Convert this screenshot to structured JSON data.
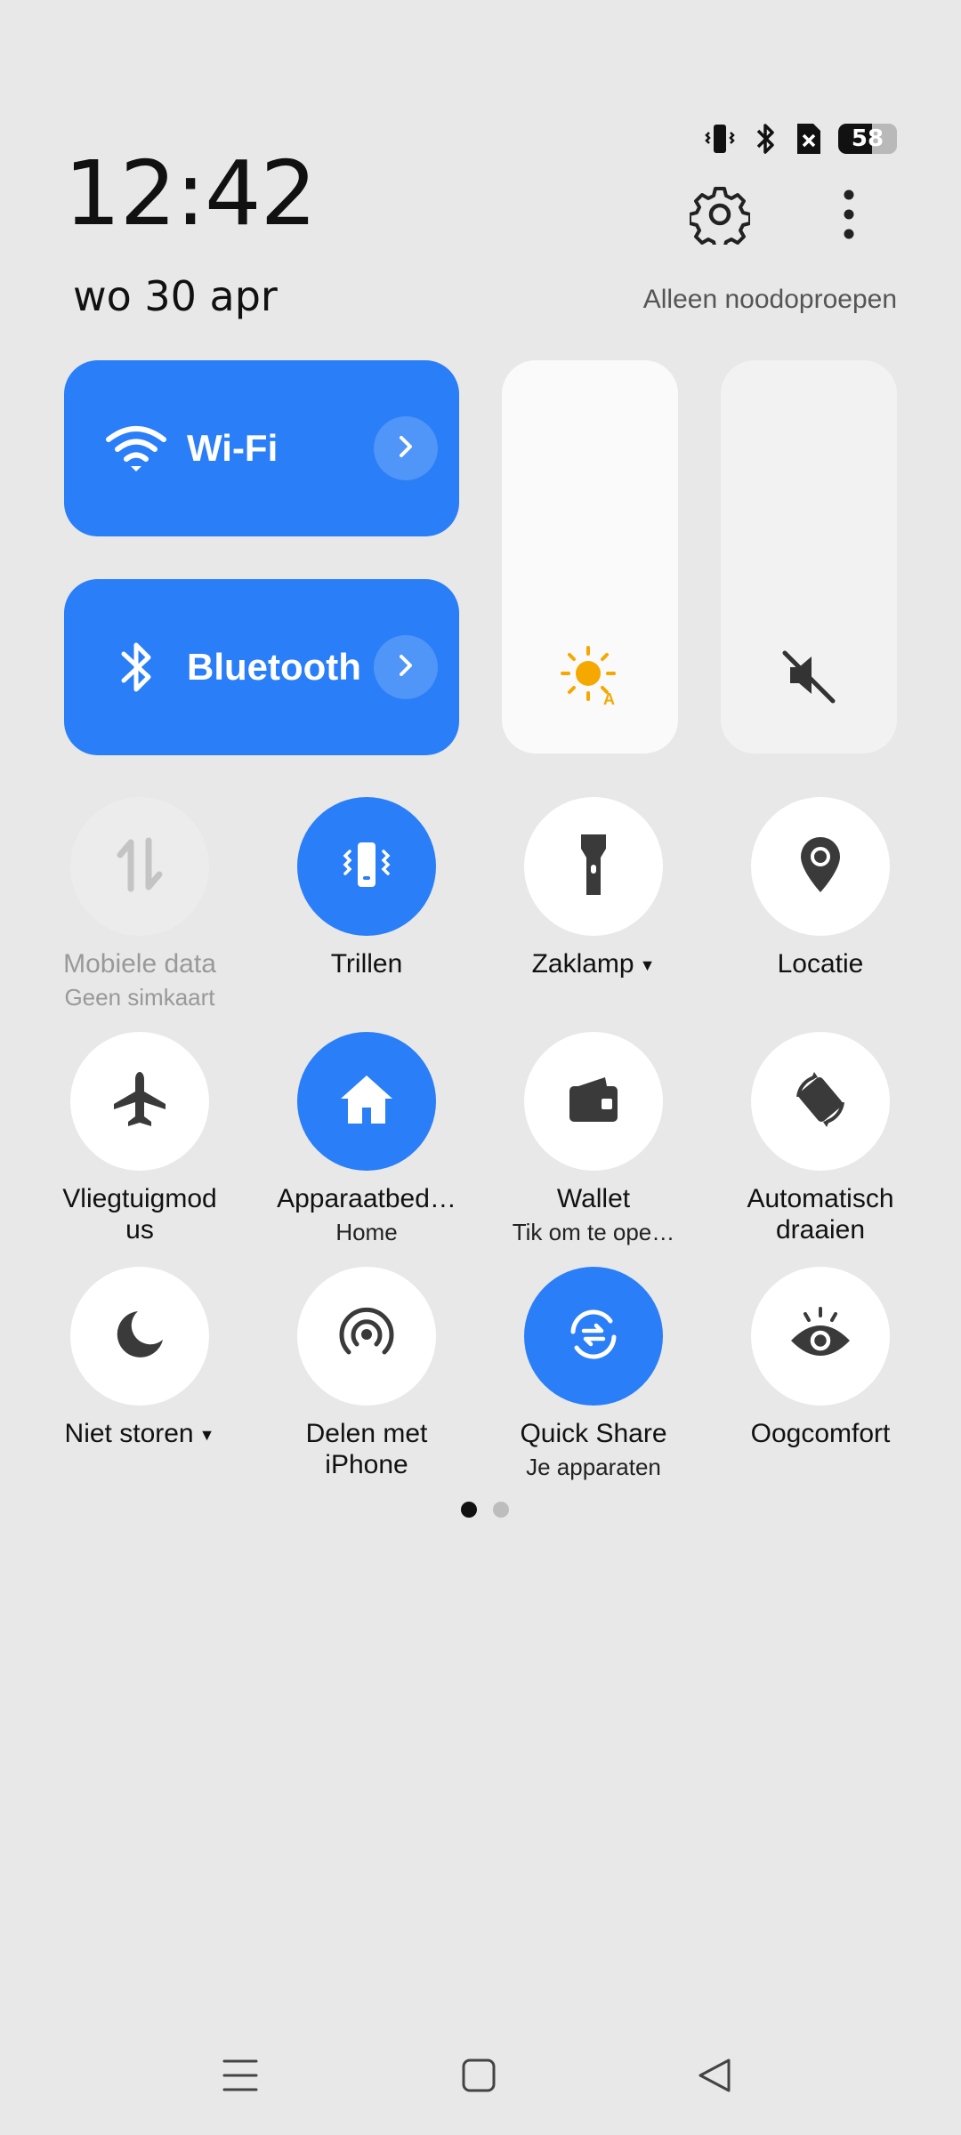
{
  "status": {
    "battery_percent": "58",
    "battery_level": 0.58
  },
  "clock": {
    "time": "12:42",
    "date": "wo 30 apr"
  },
  "header": {
    "emergency_text": "Alleen noodoproepen"
  },
  "big_tiles": {
    "wifi": {
      "label": "Wi-Fi"
    },
    "bluetooth": {
      "label": "Bluetooth"
    }
  },
  "tiles": {
    "mobile_data": {
      "label": "Mobiele data",
      "sub": "Geen simkaart"
    },
    "vibrate": {
      "label": "Trillen"
    },
    "flashlight": {
      "label": "Zaklamp",
      "has_dropdown": true
    },
    "location": {
      "label": "Locatie"
    },
    "airplane": {
      "label": "Vliegtuigmodus"
    },
    "device_controls": {
      "label": "Apparaatbed…",
      "sub": "Home"
    },
    "wallet": {
      "label": "Wallet",
      "sub": "Tik om te ope…"
    },
    "auto_rotate": {
      "label": "Automatisch draaien"
    },
    "dnd": {
      "label": "Niet storen",
      "has_dropdown": true
    },
    "share_iphone": {
      "label": "Delen met iPhone"
    },
    "quick_share": {
      "label": "Quick Share",
      "sub": "Je apparaten"
    },
    "eye_comfort": {
      "label": "Oogcomfort"
    }
  },
  "pager": {
    "pages": 2,
    "current": 1
  },
  "colors": {
    "accent": "#2a7ef7",
    "background": "#e8e8e8",
    "brightness_icon": "#f5a800"
  }
}
